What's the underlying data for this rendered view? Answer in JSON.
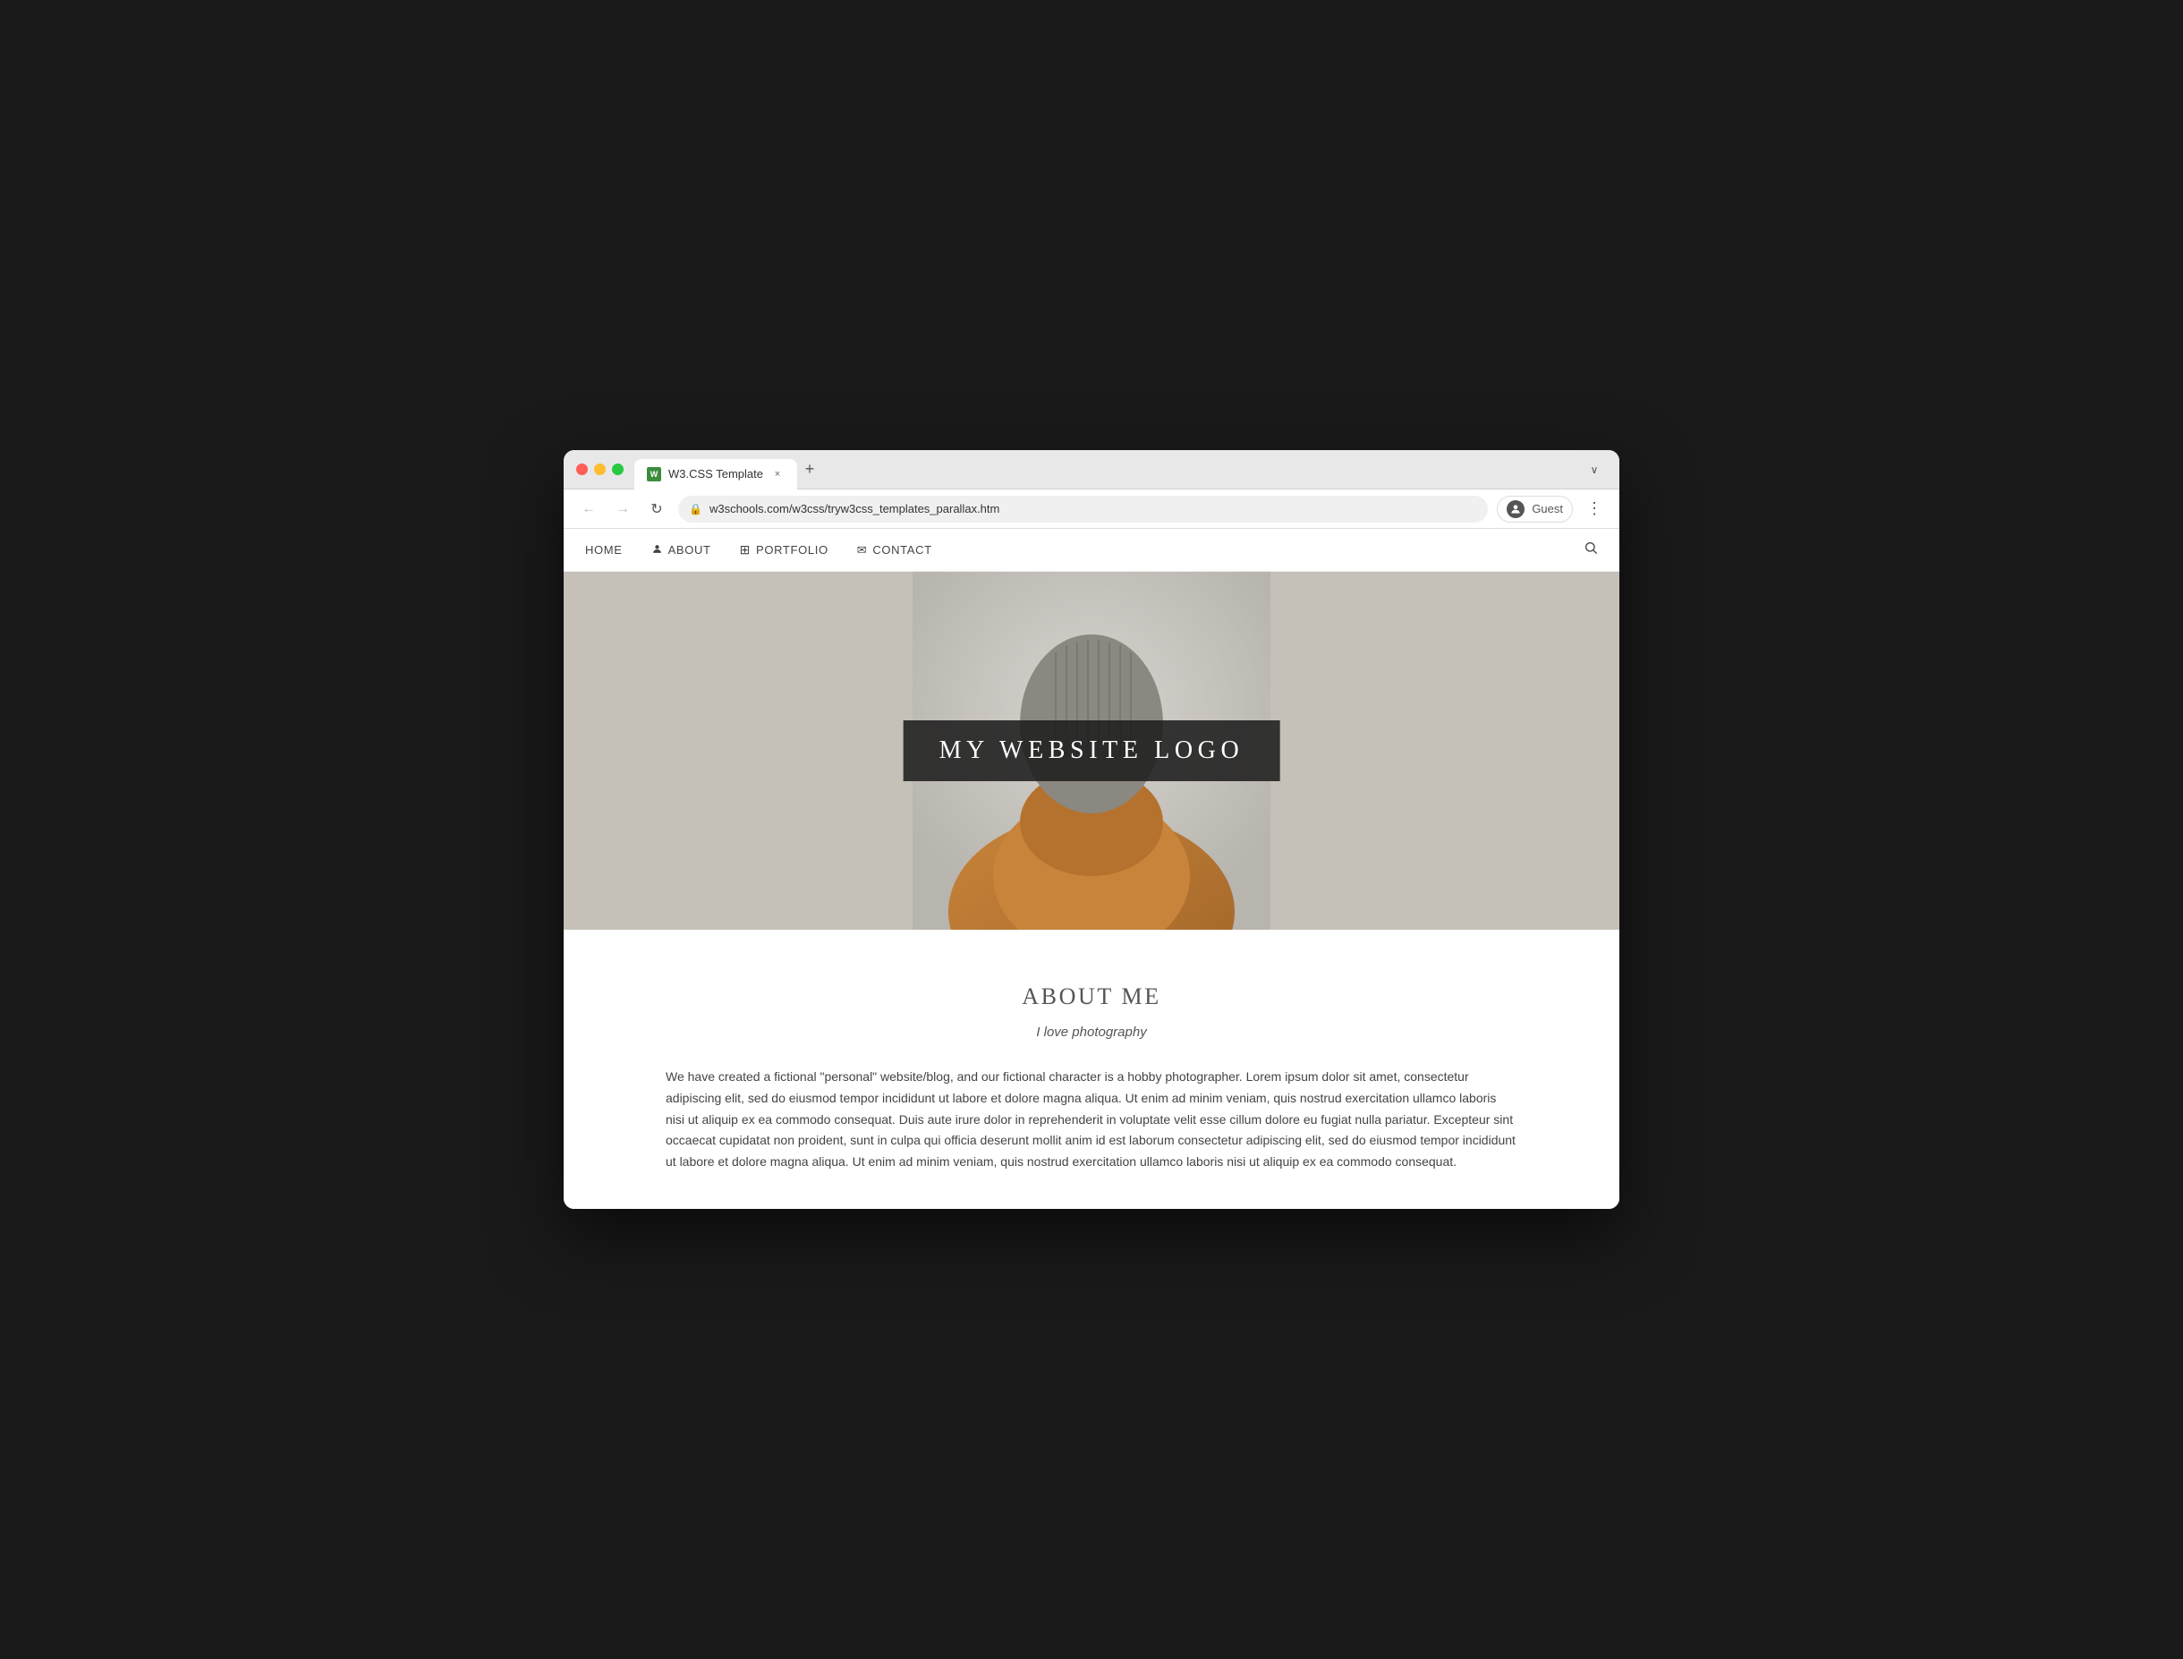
{
  "browser": {
    "tab_favicon": "W",
    "tab_title": "W3.CSS Template",
    "tab_close": "×",
    "tab_new": "+",
    "tab_collapse": "∨",
    "nav_back": "←",
    "nav_forward": "→",
    "nav_refresh": "↻",
    "url_lock": "🔒",
    "url": "w3schools.com/w3css/tryw3css_templates_parallax.htm",
    "profile_icon": "👤",
    "profile_label": "Guest",
    "menu_dots": "⋮"
  },
  "site_nav": {
    "home": "HOME",
    "about_icon": "👤",
    "about": "ABOUT",
    "portfolio_icon": "⊞",
    "portfolio": "PORTFOLIO",
    "contact_icon": "✉",
    "contact": "CONTACT",
    "search_icon": "🔍"
  },
  "hero": {
    "logo_text": "MY WEBSITE LOGO"
  },
  "about": {
    "title": "ABOUT ME",
    "subtitle": "I love photography",
    "body": "We have created a fictional \"personal\" website/blog, and our fictional character is a hobby photographer. Lorem ipsum dolor sit amet, consectetur adipiscing elit, sed do eiusmod tempor incididunt ut labore et dolore magna aliqua. Ut enim ad minim veniam, quis nostrud exercitation ullamco laboris nisi ut aliquip ex ea commodo consequat. Duis aute irure dolor in reprehenderit in voluptate velit esse cillum dolore eu fugiat nulla pariatur. Excepteur sint occaecat cupidatat non proident, sunt in culpa qui officia deserunt mollit anim id est laborum consectetur adipiscing elit, sed do eiusmod tempor incididunt ut labore et dolore magna aliqua. Ut enim ad minim veniam, quis nostrud exercitation ullamco laboris nisi ut aliquip ex ea commodo consequat."
  }
}
